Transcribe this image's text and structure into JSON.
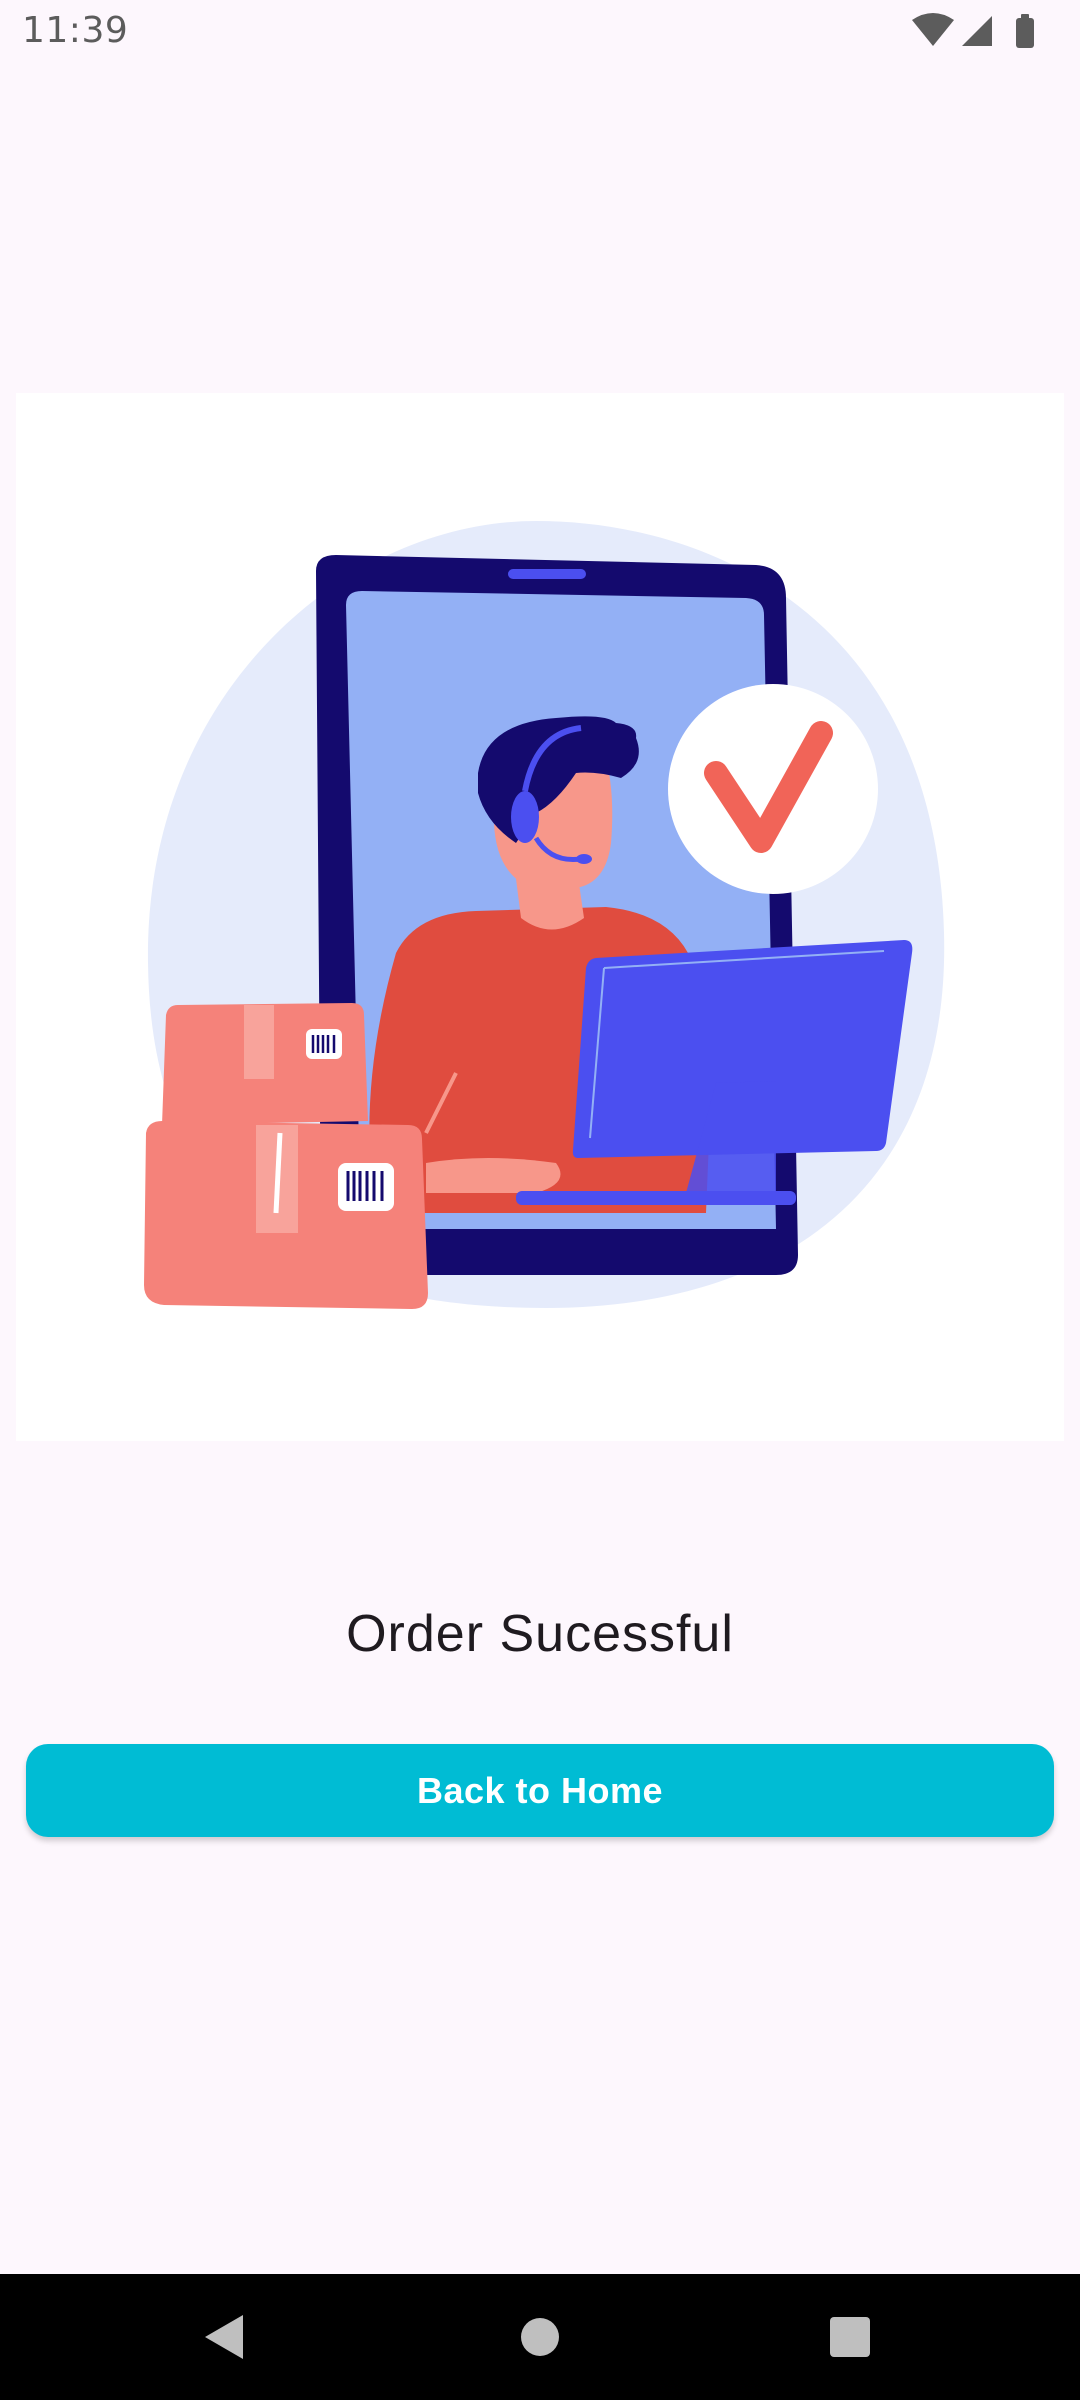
{
  "status_bar": {
    "time": "11:39",
    "icons": [
      "wifi-icon",
      "signal-icon",
      "battery-icon"
    ]
  },
  "illustration": {
    "icon": "order-success-illustration",
    "colors": {
      "phone": "#140a6e",
      "screen": "#93b0f5",
      "blob": "#e5ebfb",
      "shirt": "#e04c3f",
      "skin": "#f7978a",
      "monitor": "#4b4ff0",
      "box": "#f5827a",
      "check": "#f16458"
    }
  },
  "main": {
    "title": "Order Sucessful",
    "back_button_label": "Back to Home"
  },
  "nav_bar": {
    "buttons": [
      "back-icon",
      "home-icon",
      "recents-icon"
    ]
  },
  "colors": {
    "accent": "#00bcd4",
    "background": "#fdf7fd",
    "text": "#1f1b20"
  }
}
